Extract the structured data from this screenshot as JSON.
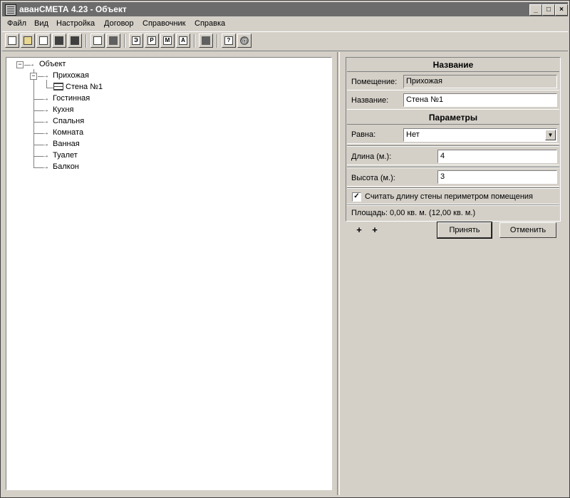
{
  "window": {
    "title": "аванСМЕТА 4.23 - Объект",
    "controls": {
      "minimize": "_",
      "maximize": "□",
      "close": "×"
    }
  },
  "menu": [
    "Файл",
    "Вид",
    "Настройка",
    "Договор",
    "Справочник",
    "Справка"
  ],
  "toolbar": {
    "buttons": [
      "new-document",
      "open-folder",
      "window",
      "save",
      "save-all",
      "preview",
      "print",
      "report-e",
      "report-p",
      "report-m",
      "report-a",
      "panel",
      "help",
      "about"
    ],
    "letters": {
      "e": "Э",
      "p": "Р",
      "m": "М",
      "a": "А",
      "help": "?",
      "about": "@"
    }
  },
  "tree": {
    "root": "Объект",
    "expander_root": "−",
    "expander_child": "−",
    "arrow": "→",
    "items": [
      {
        "label": "Прихожая",
        "children": [
          "Стена №1"
        ]
      },
      {
        "label": "Гостинная"
      },
      {
        "label": "Кухня"
      },
      {
        "label": "Спальня"
      },
      {
        "label": "Комната"
      },
      {
        "label": "Ванная"
      },
      {
        "label": "Туалет"
      },
      {
        "label": "Балкон"
      }
    ]
  },
  "props": {
    "section_name": "Название",
    "room_label": "Помещение:",
    "room_value": "Прихожая",
    "name_label": "Название:",
    "name_value": "Стена №1",
    "section_params": "Параметры",
    "equal_label": "Равна:",
    "equal_value": "Нет",
    "combo_arrow": "▼",
    "length_label": "Длина (м.):",
    "length_value": "4",
    "height_label": "Высота (м.):",
    "height_value": "3",
    "checkbox_checked": "✓",
    "checkbox_label": "Считать длину стены периметром помещения",
    "area_text": "Площадь: 0,00 кв. м. (12,00 кв. м.)"
  },
  "actions": {
    "add_icon": "+",
    "add_sub_icon": "+",
    "accept": "Принять",
    "cancel": "Отменить"
  }
}
